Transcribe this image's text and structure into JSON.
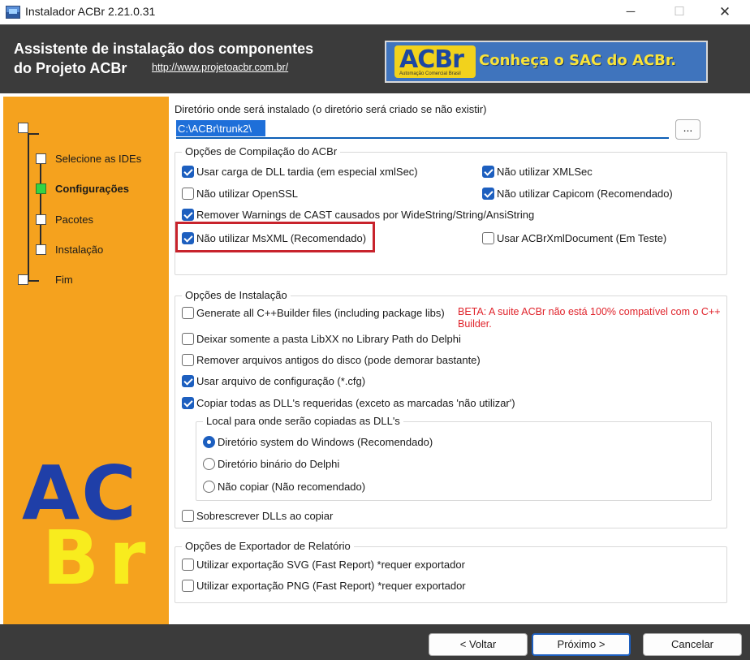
{
  "window": {
    "title": "Instalador ACBr 2.21.0.31",
    "minimize_glyph": "─",
    "maximize_glyph": "☐",
    "close_glyph": "✕"
  },
  "header": {
    "title_line1": "Assistente de instalação dos componentes",
    "title_line2": "do Projeto ACBr",
    "link": "http://www.projetoacbr.com.br/",
    "banner_logo": "ACBr",
    "banner_logo_sub": "Automação Comercial Brasil",
    "banner_text": "Conheça o SAC do ACBr."
  },
  "sidebar": {
    "steps": [
      {
        "label": "Selecione as IDEs",
        "active": false
      },
      {
        "label": "Configurações",
        "active": true
      },
      {
        "label": "Pacotes",
        "active": false
      },
      {
        "label": "Instalação",
        "active": false
      },
      {
        "label": "Fim",
        "active": false
      }
    ],
    "logo_top": "AC",
    "logo_bottom": "Br"
  },
  "directory": {
    "label": "Diretório onde será instalado (o diretório será criado se não existir)",
    "value": "C:\\ACBr\\trunk2\\",
    "browse_label": "..."
  },
  "compile_group": {
    "legend": "Opções de Compilação do ACBr",
    "options": [
      {
        "label": "Usar carga de DLL tardia (em especial xmlSec)",
        "checked": true
      },
      {
        "label": "Não utilizar XMLSec",
        "checked": true
      },
      {
        "label": "Não utilizar OpenSSL",
        "checked": false
      },
      {
        "label": "Não utilizar Capicom (Recomendado)",
        "checked": true
      },
      {
        "label": "Remover Warnings de CAST causados por WideString/String/AnsiString",
        "checked": true
      },
      {
        "label": "Não utilizar MsXML (Recomendado)",
        "checked": true
      },
      {
        "label": "Usar ACBrXmlDocument (Em Teste)",
        "checked": false
      }
    ]
  },
  "install_group": {
    "legend": "Opções de Instalação",
    "options": [
      {
        "label": "Generate all C++Builder files (including package libs)",
        "checked": false
      },
      {
        "label": "Deixar somente a pasta LibXX no Library Path do Delphi",
        "checked": false
      },
      {
        "label": "Remover arquivos antigos do disco (pode demorar bastante)",
        "checked": false
      },
      {
        "label": "Usar arquivo de configuração (*.cfg)",
        "checked": true
      },
      {
        "label": "Copiar todas as DLL's requeridas (exceto as marcadas 'não utilizar')",
        "checked": true
      },
      {
        "label": "Sobrescrever DLLs ao copiar",
        "checked": false
      }
    ],
    "beta_note": "BETA: A suite ACBr não está 100% compatível com o C++ Builder.",
    "dll_group": {
      "legend": "Local para onde serão copiadas as DLL's",
      "options": [
        {
          "label": "Diretório system do Windows (Recomendado)",
          "selected": true
        },
        {
          "label": "Diretório binário do Delphi",
          "selected": false
        },
        {
          "label": "Não copiar (Não recomendado)",
          "selected": false
        }
      ]
    }
  },
  "export_group": {
    "legend": "Opções de Exportador de Relatório",
    "options": [
      {
        "label": "Utilizar exportação SVG (Fast Report) *requer exportador",
        "checked": false
      },
      {
        "label": "Utilizar exportação PNG (Fast Report) *requer exportador",
        "checked": false
      }
    ]
  },
  "footer": {
    "back_label": "< Voltar",
    "next_label": "Próximo >",
    "cancel_label": "Cancelar"
  },
  "colors": {
    "sidebar_bg": "#f5a21e",
    "header_bg": "#3b3b3b",
    "checkbox_accent": "#1d5fbf",
    "highlight_border": "#c8232c",
    "beta_text": "#e0232b",
    "logo_blue": "#1f3fa8",
    "logo_yellow": "#f8ec1e",
    "active_step": "#33d444"
  }
}
